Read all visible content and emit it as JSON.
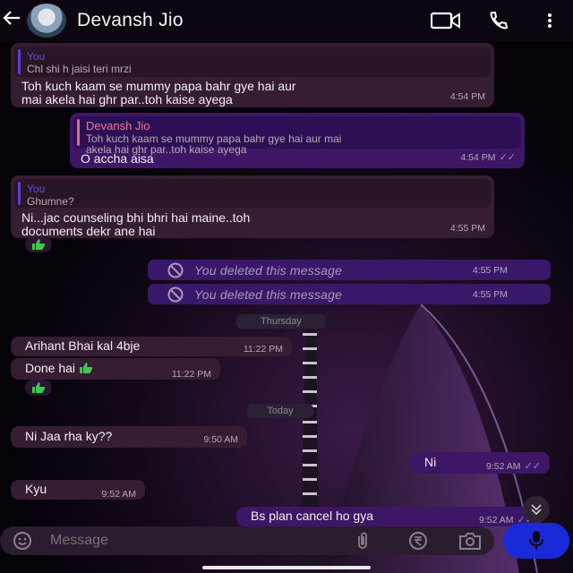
{
  "header": {
    "contact_name": "Devansh Jio",
    "icons": [
      "back-arrow-icon",
      "video-call-icon",
      "phone-icon",
      "more-vertical-icon"
    ]
  },
  "messages": [
    {
      "id": "m1",
      "dir": "in",
      "quote_name": "You",
      "quote_text": "Chl shi h jaisi teri mrzi",
      "lines": [
        "Toh kuch kaam se mummy papa bahr gye hai aur",
        "mai akela hai ghr par..toh kaise ayega"
      ],
      "time": "4:54 PM"
    },
    {
      "id": "m2",
      "dir": "out",
      "quote_name": "Devansh Jio",
      "quote_lines": [
        "Toh kuch kaam se mummy papa bahr gye hai aur mai",
        "akela hai ghr par..toh kaise ayega"
      ],
      "lines": [
        "O accha aisa"
      ],
      "time": "4:54 PM"
    },
    {
      "id": "m3",
      "dir": "in",
      "quote_name": "You",
      "quote_text": "Ghumne?",
      "lines": [
        "Ni...jac counseling bhi bhri hai maine..toh",
        "documents dekr ane hai"
      ],
      "time": "4:55 PM"
    }
  ],
  "deleted": [
    {
      "text": "You deleted this message",
      "time": "4:55 PM"
    },
    {
      "text": "You deleted this message",
      "time": "4:55 PM"
    }
  ],
  "dates": {
    "thursday": "Thursday",
    "today": "Today"
  },
  "short_messages": [
    {
      "text": "Arihant Bhai kal 4bje",
      "time": "11:22 PM"
    },
    {
      "text": "Done hai",
      "time": "11:22 PM",
      "emoji": "thumbs-up-icon"
    },
    {
      "text": "Ni Jaa rha ky??",
      "time": "9:50 AM"
    },
    {
      "text": "Ni",
      "time": "9:52 AM"
    },
    {
      "text": "Kyu",
      "time": "9:52 AM"
    },
    {
      "text": "Bs plan cancel ho gya",
      "time": "9:52 AM"
    }
  ],
  "composer": {
    "placeholder": "Message",
    "icons": [
      "emoji-icon",
      "attach-icon",
      "rupee-payment-icon",
      "camera-icon",
      "mic-icon"
    ]
  },
  "colors": {
    "accent": "#1a2ad9",
    "outgoing_bubble": "#3d1666",
    "incoming_bubble": "#361d31",
    "read_ticks": "#a07ae6",
    "reaction": "#3cc84a"
  }
}
